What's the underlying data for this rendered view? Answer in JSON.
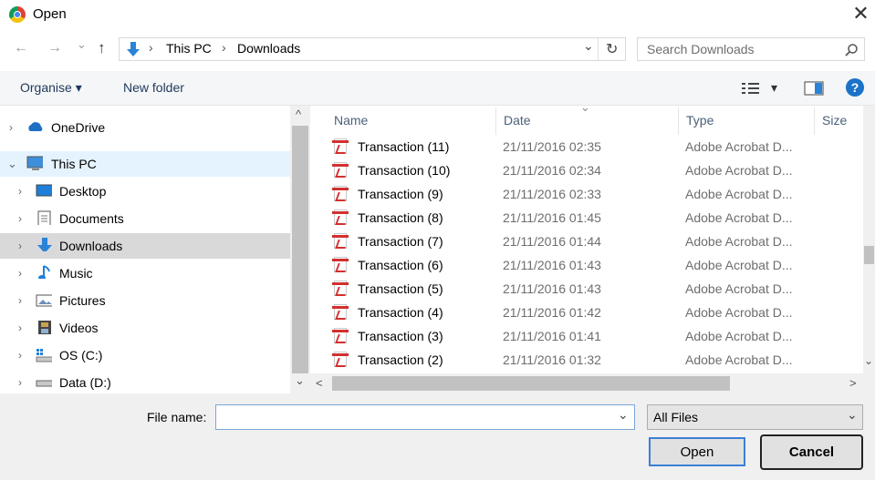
{
  "window": {
    "title": "Open",
    "close_glyph": "✕"
  },
  "nav": {
    "back_glyph": "←",
    "forward_glyph": "→",
    "recent_glyph": "⌄",
    "up_glyph": "↑",
    "breadcrumb": [
      "This PC",
      "Downloads"
    ],
    "separator_glyph": "›",
    "dropdown_glyph": "⌄",
    "refresh_glyph": "↻",
    "search_placeholder": "Search Downloads"
  },
  "toolbar": {
    "organise_label": "Organise",
    "organise_glyph": "▾",
    "new_folder_label": "New folder",
    "view_glyph": "▾",
    "help_glyph": "?"
  },
  "sidebar": {
    "items": [
      {
        "label": "OneDrive",
        "icon": "cloud-icon",
        "expanded": false
      },
      {
        "label": "This PC",
        "icon": "computer-icon",
        "expanded": true
      },
      {
        "label": "Desktop",
        "icon": "desktop-icon",
        "expanded": false
      },
      {
        "label": "Documents",
        "icon": "documents-icon",
        "expanded": false
      },
      {
        "label": "Downloads",
        "icon": "downloads-icon",
        "expanded": false,
        "selected": true
      },
      {
        "label": "Music",
        "icon": "music-icon",
        "expanded": false
      },
      {
        "label": "Pictures",
        "icon": "pictures-icon",
        "expanded": false
      },
      {
        "label": "Videos",
        "icon": "videos-icon",
        "expanded": false
      },
      {
        "label": "OS (C:)",
        "icon": "os-drive-icon",
        "expanded": false
      },
      {
        "label": "Data (D:)",
        "icon": "drive-icon",
        "expanded": false
      }
    ],
    "scroll_up_glyph": "^",
    "scroll_down_glyph": "⌄"
  },
  "file_list": {
    "columns": [
      "Name",
      "Date",
      "Type",
      "Size"
    ],
    "sort_glyph": "⌄",
    "rows": [
      {
        "name": "Transaction (11)",
        "date": "21/11/2016 02:35",
        "type": "Adobe Acrobat D..."
      },
      {
        "name": "Transaction (10)",
        "date": "21/11/2016 02:34",
        "type": "Adobe Acrobat D..."
      },
      {
        "name": "Transaction (9)",
        "date": "21/11/2016 02:33",
        "type": "Adobe Acrobat D..."
      },
      {
        "name": "Transaction (8)",
        "date": "21/11/2016 01:45",
        "type": "Adobe Acrobat D..."
      },
      {
        "name": "Transaction (7)",
        "date": "21/11/2016 01:44",
        "type": "Adobe Acrobat D..."
      },
      {
        "name": "Transaction (6)",
        "date": "21/11/2016 01:43",
        "type": "Adobe Acrobat D..."
      },
      {
        "name": "Transaction (5)",
        "date": "21/11/2016 01:43",
        "type": "Adobe Acrobat D..."
      },
      {
        "name": "Transaction (4)",
        "date": "21/11/2016 01:42",
        "type": "Adobe Acrobat D..."
      },
      {
        "name": "Transaction (3)",
        "date": "21/11/2016 01:41",
        "type": "Adobe Acrobat D..."
      },
      {
        "name": "Transaction (2)",
        "date": "21/11/2016 01:32",
        "type": "Adobe Acrobat D..."
      }
    ],
    "scroll_left_glyph": "<",
    "scroll_right_glyph": ">",
    "scroll_up_glyph": "^",
    "scroll_down_glyph": "⌄"
  },
  "footer": {
    "file_name_label": "File name:",
    "file_name_value": "",
    "file_name_dropdown_glyph": "⌄",
    "filter_value": "All Files",
    "filter_dropdown_glyph": "⌄",
    "open_label": "Open",
    "cancel_label": "Cancel"
  },
  "colors": {
    "accent": "#0078d7",
    "selected_bg": "#d9d9d9",
    "hover_bg": "#e5f3ff"
  }
}
